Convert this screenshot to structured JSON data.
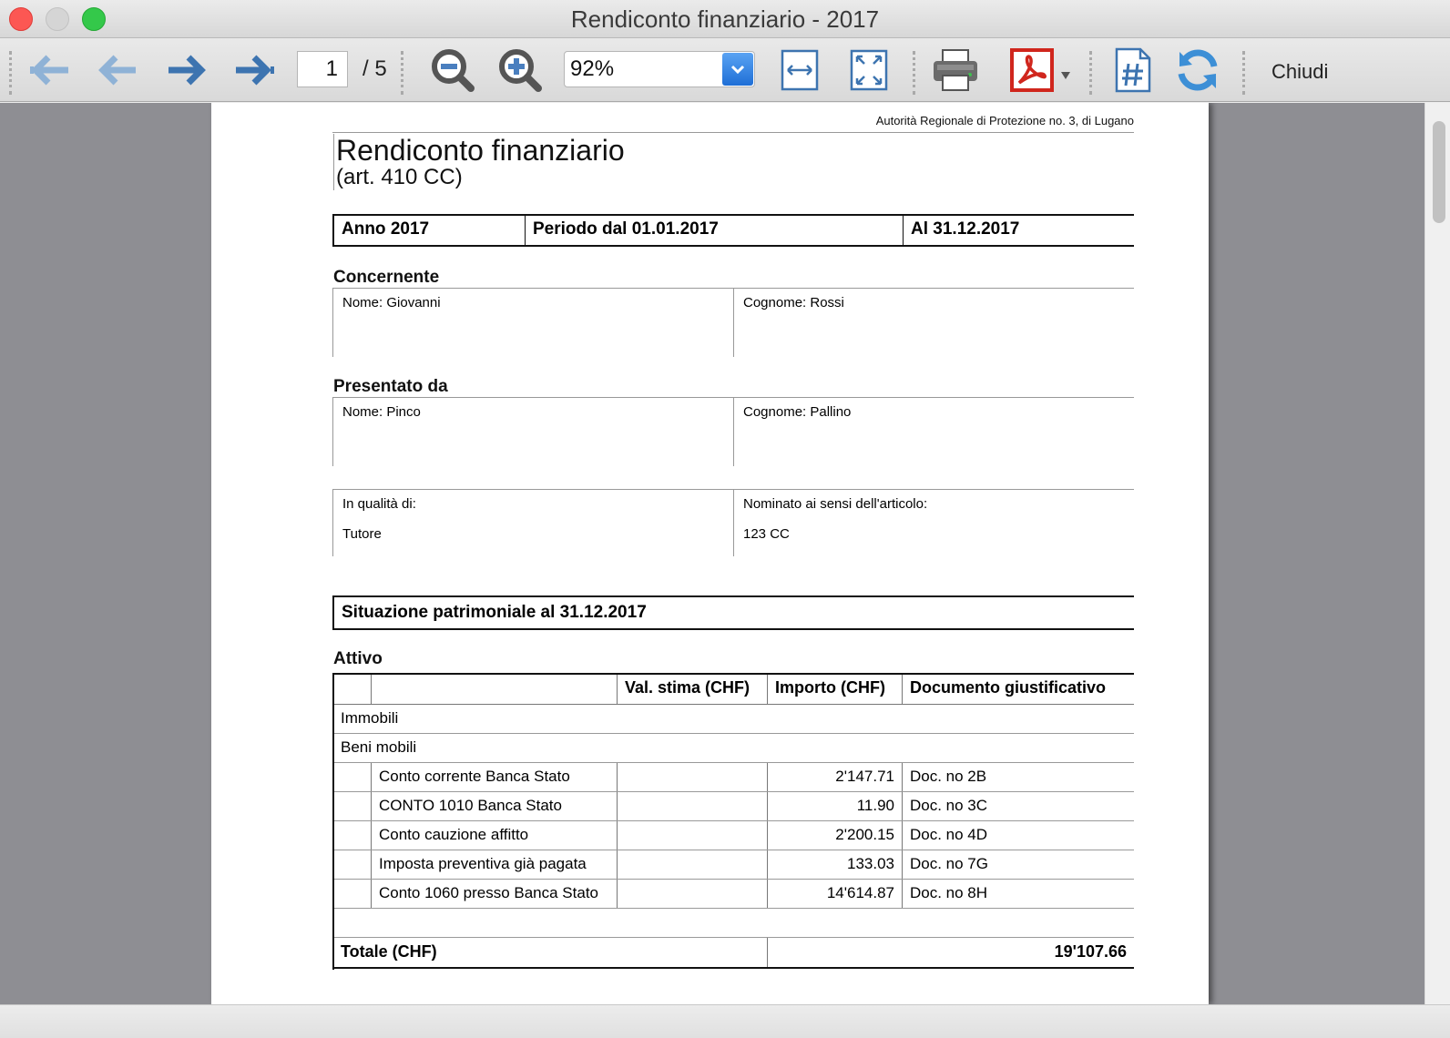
{
  "window": {
    "title": "Rendiconto finanziario - 2017"
  },
  "toolbar": {
    "page_current": "1",
    "page_total": "/ 5",
    "zoom": "92%",
    "close_label": "Chiudi",
    "icons": [
      "first-page-icon",
      "previous-page-icon",
      "next-page-icon",
      "last-page-icon",
      "zoom-out-icon",
      "zoom-in-icon",
      "fit-width-icon",
      "fit-page-icon",
      "print-icon",
      "pdf-icon",
      "page-number-icon",
      "refresh-icon"
    ]
  },
  "document": {
    "authority": "Autorità Regionale di Protezione no. 3, di Lugano",
    "title": "Rendiconto finanziario",
    "subtitle": "(art. 410 CC)",
    "period": {
      "year": "Anno 2017",
      "from": "Periodo dal 01.01.2017",
      "to": "Al 31.12.2017"
    },
    "concernente": {
      "label": "Concernente",
      "nome": "Nome: Giovanni",
      "cognome": "Cognome: Rossi"
    },
    "presentato": {
      "label": "Presentato da",
      "nome": "Nome: Pinco",
      "cognome": "Cognome: Pallino"
    },
    "qualita": {
      "label": "In qualità di:",
      "value": "Tutore",
      "articolo_label": "Nominato ai sensi dell'articolo:",
      "articolo_value": "123 CC"
    },
    "situazione": "Situazione patrimoniale al 31.12.2017",
    "attivo": {
      "label": "Attivo",
      "headers": [
        "",
        "",
        "Val. stima (CHF)",
        "Importo (CHF)",
        "Documento giustificativo"
      ],
      "immobili": "Immobili",
      "beni_mobili": "Beni mobili",
      "rows": [
        {
          "desc": "Conto corrente Banca Stato",
          "stima": "",
          "importo": "2'147.71",
          "doc": "Doc. no 2B"
        },
        {
          "desc": "CONTO 1010 Banca Stato",
          "stima": "",
          "importo": "11.90",
          "doc": "Doc. no 3C"
        },
        {
          "desc": "Conto cauzione affitto",
          "stima": "",
          "importo": "2'200.15",
          "doc": "Doc. no 4D"
        },
        {
          "desc": "Imposta preventiva già pagata",
          "stima": "",
          "importo": "133.03",
          "doc": "Doc. no 7G"
        },
        {
          "desc": "Conto 1060 presso Banca Stato",
          "stima": "",
          "importo": "14'614.87",
          "doc": "Doc. no 8H"
        }
      ],
      "total_label": "Totale (CHF)",
      "total_value": "19'107.66"
    }
  }
}
